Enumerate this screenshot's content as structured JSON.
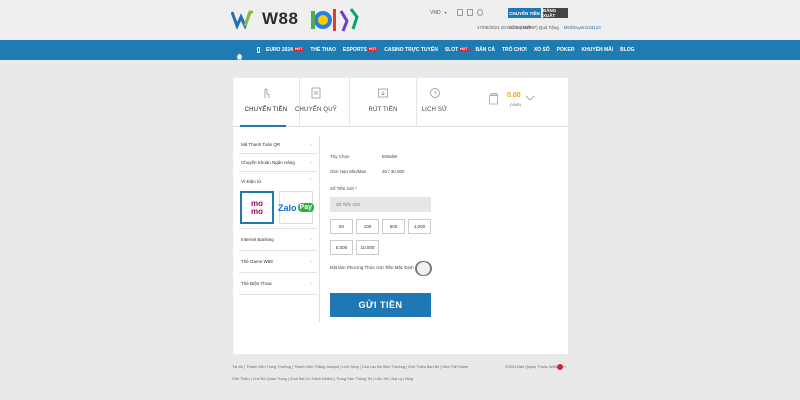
{
  "header": {
    "brand": "W88",
    "currency": "VND",
    "datetime": "17/06/2024 20:05:30 (GMT+7)",
    "points_label": "Số Dư Điểm",
    "gift_label": "Quà Tặng",
    "username": "Minhhuyen123123",
    "deposit_button": "CHUYỂN TIỀN",
    "logout_button": "ĐĂNG XUẤT"
  },
  "nav": {
    "items": [
      {
        "label": "EURO 2024",
        "tag": "HOT"
      },
      {
        "label": "THỂ THAO",
        "tag": ""
      },
      {
        "label": "ESPORTS",
        "tag": "HOT"
      },
      {
        "label": "CASINO TRỰC TUYẾN",
        "tag": ""
      },
      {
        "label": "SLOT",
        "tag": "HOT"
      },
      {
        "label": "BẮN CÁ",
        "tag": ""
      },
      {
        "label": "TRÒ CHƠI",
        "tag": ""
      },
      {
        "label": "XỔ SỐ",
        "tag": ""
      },
      {
        "label": "POKER",
        "tag": ""
      },
      {
        "label": "KHUYẾN MÃI",
        "tag": ""
      },
      {
        "label": "BLOG",
        "tag": ""
      }
    ]
  },
  "tabs": [
    {
      "label": "CHUYỂN TIỀN",
      "icon": "hand-tap-icon"
    },
    {
      "label": "CHUYỂN QUỸ",
      "icon": "transfer-icon"
    },
    {
      "label": "RÚT TIỀN",
      "icon": "withdraw-icon"
    },
    {
      "label": "LỊCH SỬ",
      "icon": "history-icon"
    }
  ],
  "balance": {
    "amount": "0.00",
    "currency": "(VND)"
  },
  "sidebar": {
    "items": [
      {
        "label": "Mã Thanh Toán QR"
      },
      {
        "label": "Chuyển Khoản Ngân Hàng"
      },
      {
        "label": "Ví Điện tử"
      },
      {
        "label": "Internet Banking"
      },
      {
        "label": "Thẻ Game W88"
      },
      {
        "label": "Thẻ Điện Thoại"
      }
    ],
    "wallets": [
      {
        "name": "MoMo",
        "line1": "mo",
        "line2": "mo",
        "selected": true
      },
      {
        "name": "ZaloPay",
        "line1": "Zalo",
        "line2": "Pay",
        "selected": false
      }
    ]
  },
  "form": {
    "option_label": "Tùy Chọn",
    "option_value": "EWallet",
    "limit_label": "Giới Hạn Min/Max",
    "limit_value": "30 / 30,000",
    "amount_label": "Số Tiền Gửi",
    "amount_required": "*",
    "amount_placeholder": "Số Tiền Gửi",
    "chips": [
      "50",
      "100",
      "500",
      "1,000",
      "5,000",
      "10,000"
    ],
    "default_method_label": "Đặt làm Phương Thức Gửi Tiền Mặc Định",
    "submit_label": "GỬI TIỀN"
  },
  "footer": {
    "line1": "Tài xỉu | Thành Viên Trung Thưởng | Thành Viên Thắng Jackpot | Lịch Sexy | Câu Lạc Bộ Siêu Thưởng | Giới Thiệu Bạn Bè | Nhà Thể Game",
    "line2": "Giới Thiệu | Chế Độ Quan Trọng | Chơi Bài Có Trách Nhiệm | Trung Tâm Thông Tin | Liên Hệ | Đại Lý | Blog",
    "copyright": "©2024 Bản Quyền Thuộc W88 | 21+"
  },
  "colors": {
    "primary": "#1f78b4",
    "accent": "#f0a500",
    "hot_tag": "#e0202a"
  }
}
